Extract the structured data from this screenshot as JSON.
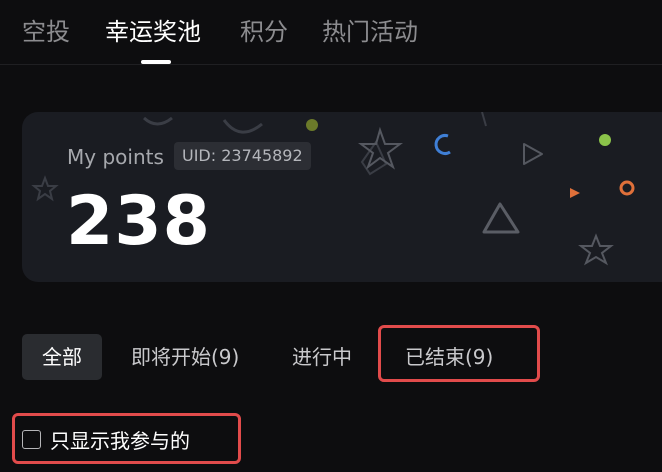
{
  "top_tabs": [
    {
      "label": "空投",
      "active": false
    },
    {
      "label": "幸运奖池",
      "active": true
    },
    {
      "label": "积分",
      "active": false
    },
    {
      "label": "热门活动",
      "active": false
    }
  ],
  "points_card": {
    "label": "My points",
    "uid": "UID: 23745892",
    "value": "238"
  },
  "filter_tabs": [
    {
      "label": "全部",
      "active": true
    },
    {
      "label": "即将开始(9)",
      "active": false
    },
    {
      "label": "进行中",
      "active": false
    },
    {
      "label": "已结束(9)",
      "active": false,
      "highlighted": true
    }
  ],
  "only_mine": {
    "label": "只显示我参与的",
    "checked": false,
    "highlighted": true
  },
  "colors": {
    "background": "#0d0d0f",
    "card": "#1a1c22",
    "highlight": "#e14b4b",
    "deco_green": "#8bc34a",
    "deco_orange": "#e0703a",
    "deco_blue": "#3f7fd6"
  }
}
